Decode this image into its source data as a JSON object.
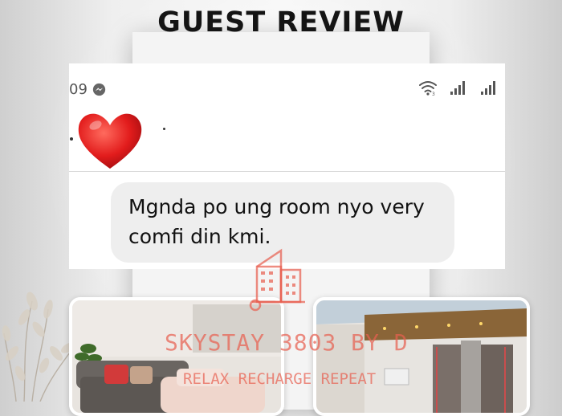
{
  "header": {
    "title": "GUEST REVIEW"
  },
  "screenshot": {
    "status_time": "09",
    "status_icons": [
      "messenger-icon",
      "wifi-icon",
      "signal-icon",
      "signal-icon"
    ],
    "message": {
      "line1": "Mgnda po ung room nyo very",
      "line2": "comfi din kmi."
    }
  },
  "watermark": {
    "brand": "SKYSTAY 3803 BY D",
    "tagline": "RELAX RECHARGE REPEAT",
    "color": "#e85f50"
  },
  "colors": {
    "heart": "#e21c1c",
    "bubble": "#eeeeee",
    "title": "#141414"
  }
}
